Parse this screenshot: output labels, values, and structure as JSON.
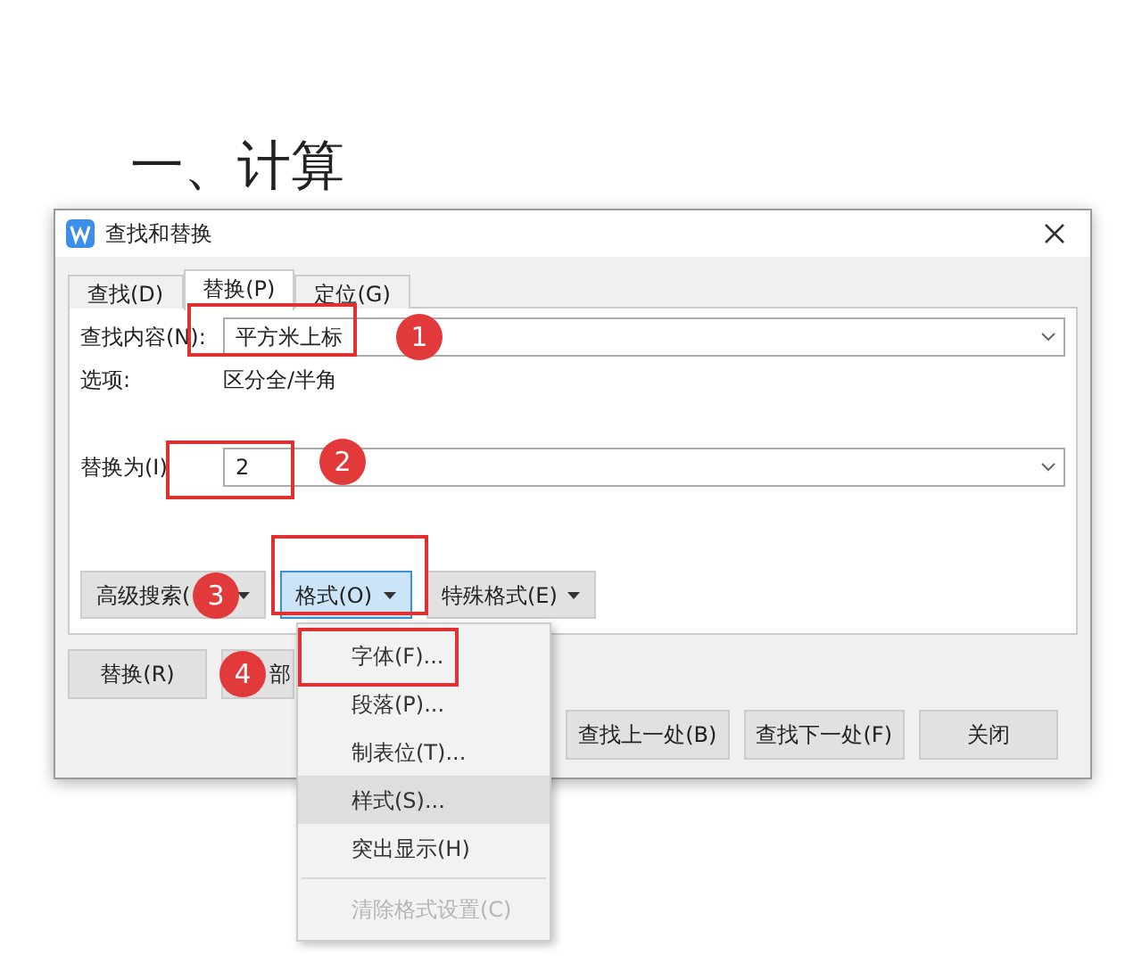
{
  "document": {
    "heading": "一、计算"
  },
  "dialog": {
    "title": "查找和替换"
  },
  "tabs": [
    {
      "label": "查找(D)",
      "selected": false
    },
    {
      "label": "替换(P)",
      "selected": true
    },
    {
      "label": "定位(G)",
      "selected": false
    }
  ],
  "find": {
    "label": "查找内容(N):",
    "value": "平方米上标"
  },
  "options": {
    "label": "选项:",
    "value": "区分全/半角"
  },
  "replace": {
    "label": "替换为(I)",
    "value": "2"
  },
  "format_buttons": [
    {
      "label": "高级搜索(",
      "pressed": false
    },
    {
      "label": "格式(O)",
      "pressed": true
    },
    {
      "label": "特殊格式(E)",
      "pressed": false
    }
  ],
  "action_buttons": [
    "替换(R)",
    "部"
  ],
  "nav_buttons": [
    "查找上一处(B)",
    "查找下一处(F)",
    "关闭"
  ],
  "format_menu": [
    {
      "label": "字体(F)...",
      "hovered": false,
      "disabled": false,
      "separator_before": false
    },
    {
      "label": "段落(P)...",
      "hovered": false,
      "disabled": false,
      "separator_before": false
    },
    {
      "label": "制表位(T)...",
      "hovered": false,
      "disabled": false,
      "separator_before": false
    },
    {
      "label": "样式(S)...",
      "hovered": true,
      "disabled": false,
      "separator_before": false
    },
    {
      "label": "突出显示(H)",
      "hovered": false,
      "disabled": false,
      "separator_before": false
    },
    {
      "label": "清除格式设置(C)",
      "hovered": false,
      "disabled": true,
      "separator_before": true
    }
  ],
  "callouts": [
    {
      "number": "1"
    },
    {
      "number": "2"
    },
    {
      "number": "3"
    },
    {
      "number": "4"
    }
  ]
}
